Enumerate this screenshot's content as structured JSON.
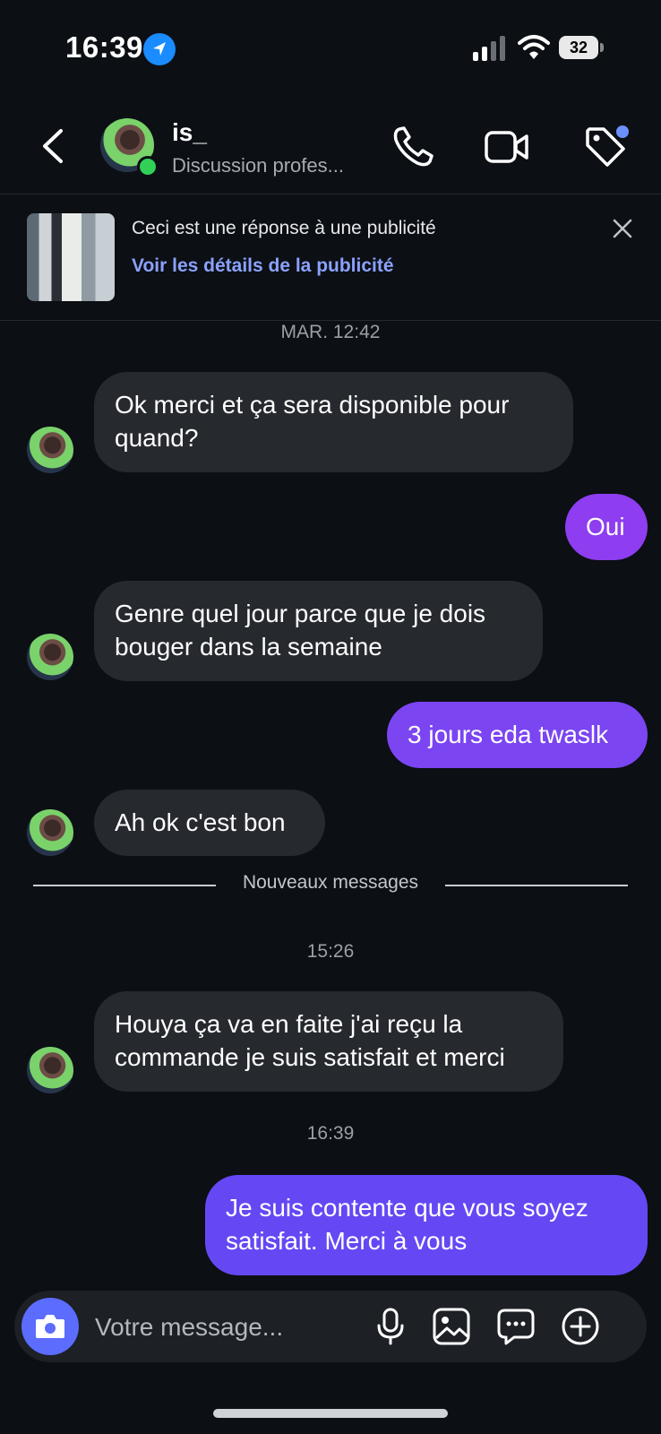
{
  "status_bar": {
    "time": "16:39",
    "battery": "32"
  },
  "header": {
    "contact_name": "is_",
    "contact_subtitle": "Discussion profes..."
  },
  "ad_banner": {
    "title": "Ceci est une réponse à une publicité",
    "link": "Voir les détails de la publicité"
  },
  "thread": {
    "timestamp_1": "MAR. 12:42",
    "messages": [
      {
        "direction": "in",
        "text": "Ok merci et ça sera disponible pour quand?"
      },
      {
        "direction": "out",
        "text": "Oui"
      },
      {
        "direction": "in",
        "text": "Genre quel jour parce que je dois bouger dans la semaine"
      },
      {
        "direction": "out",
        "text": "3 jours eda twaslk"
      },
      {
        "direction": "in",
        "text": "Ah ok c'est bon"
      },
      {
        "direction": "in",
        "text": "Houya ça va en faite j'ai reçu la commande je suis satisfait et merci"
      },
      {
        "direction": "out",
        "text": "Je suis contente que vous soyez satisfait. Merci à vous"
      }
    ],
    "new_messages_label": "Nouveaux messages",
    "timestamp_2": "15:26",
    "timestamp_3": "16:39"
  },
  "composer": {
    "placeholder": "Votre message..."
  },
  "colors": {
    "accent_purple": "#8e3df0",
    "accent_blue": "#5b6cff",
    "incoming_bubble": "#26292e",
    "online": "#31d158"
  }
}
